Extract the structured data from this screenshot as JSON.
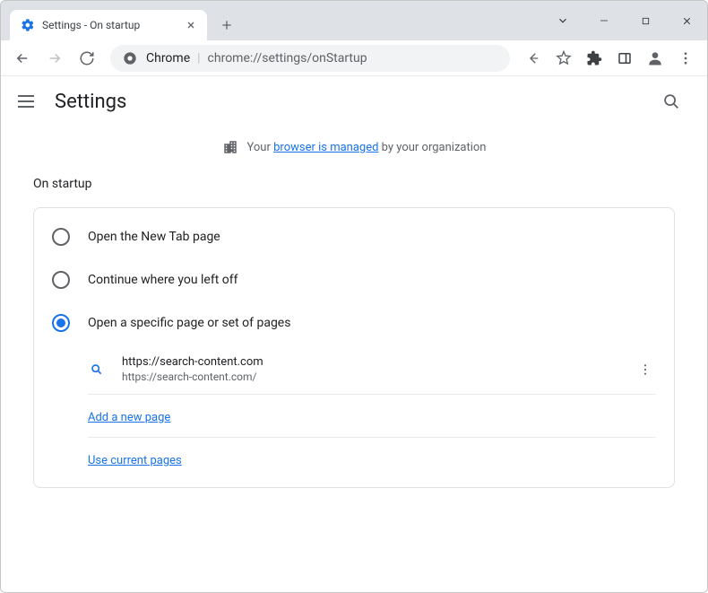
{
  "window": {
    "tab_title": "Settings - On startup"
  },
  "addressbar": {
    "host_label": "Chrome",
    "url": "chrome://settings/onStartup"
  },
  "header": {
    "title": "Settings"
  },
  "managed": {
    "prefix": "Your ",
    "link": "browser is managed",
    "suffix": " by your organization"
  },
  "section": {
    "title": "On startup"
  },
  "radios": {
    "new_tab": "Open the New Tab page",
    "continue": "Continue where you left off",
    "specific": "Open a specific page or set of pages"
  },
  "pages": [
    {
      "name": "https://search-content.com",
      "url": "https://search-content.com/"
    }
  ],
  "links": {
    "add_page": "Add a new page",
    "use_current": "Use current pages"
  }
}
